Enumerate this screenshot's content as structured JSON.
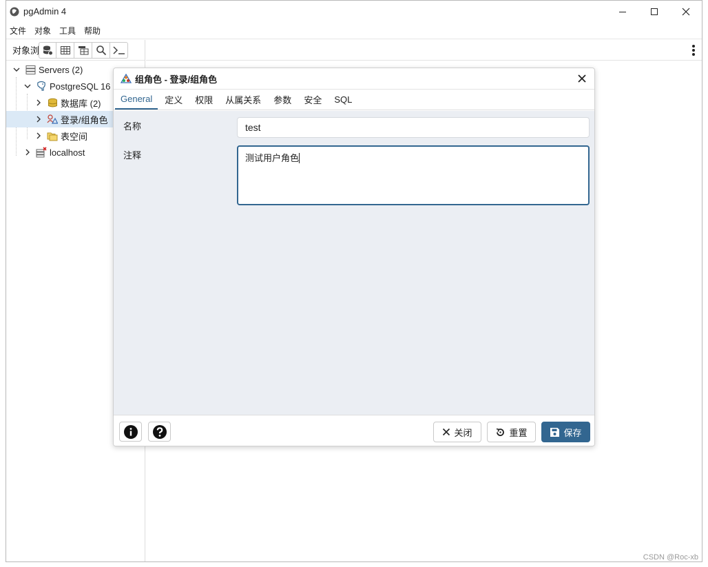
{
  "window": {
    "title": "pgAdmin 4",
    "menu": [
      "文件",
      "对象",
      "工具",
      "帮助"
    ]
  },
  "browser": {
    "tab_label": "对象浏览器",
    "tree": [
      {
        "label": "Servers (2)",
        "level": 0,
        "expanded": true
      },
      {
        "label": "PostgreSQL 16",
        "level": 1,
        "expanded": true
      },
      {
        "label": "数据库 (2)",
        "level": 2,
        "expanded": false
      },
      {
        "label": "登录/组角色",
        "level": 2,
        "expanded": false,
        "selected": true
      },
      {
        "label": "表空间",
        "level": 2,
        "expanded": false
      },
      {
        "label": "localhost",
        "level": 1,
        "expanded": false
      }
    ]
  },
  "dialog": {
    "title": "组角色 - 登录/组角色",
    "tabs": [
      "General",
      "定义",
      "权限",
      "从属关系",
      "参数",
      "安全",
      "SQL"
    ],
    "active_tab": "General",
    "fields": {
      "name_label": "名称",
      "name_value": "test",
      "comment_label": "注释",
      "comment_value": "测试用户角色"
    },
    "buttons": {
      "close": "关闭",
      "reset": "重置",
      "save": "保存"
    }
  },
  "watermark": "CSDN @Roc-xb",
  "colors": {
    "accent": "#326690",
    "body_bg": "#ebeef3",
    "selection": "#dbe9f6"
  }
}
